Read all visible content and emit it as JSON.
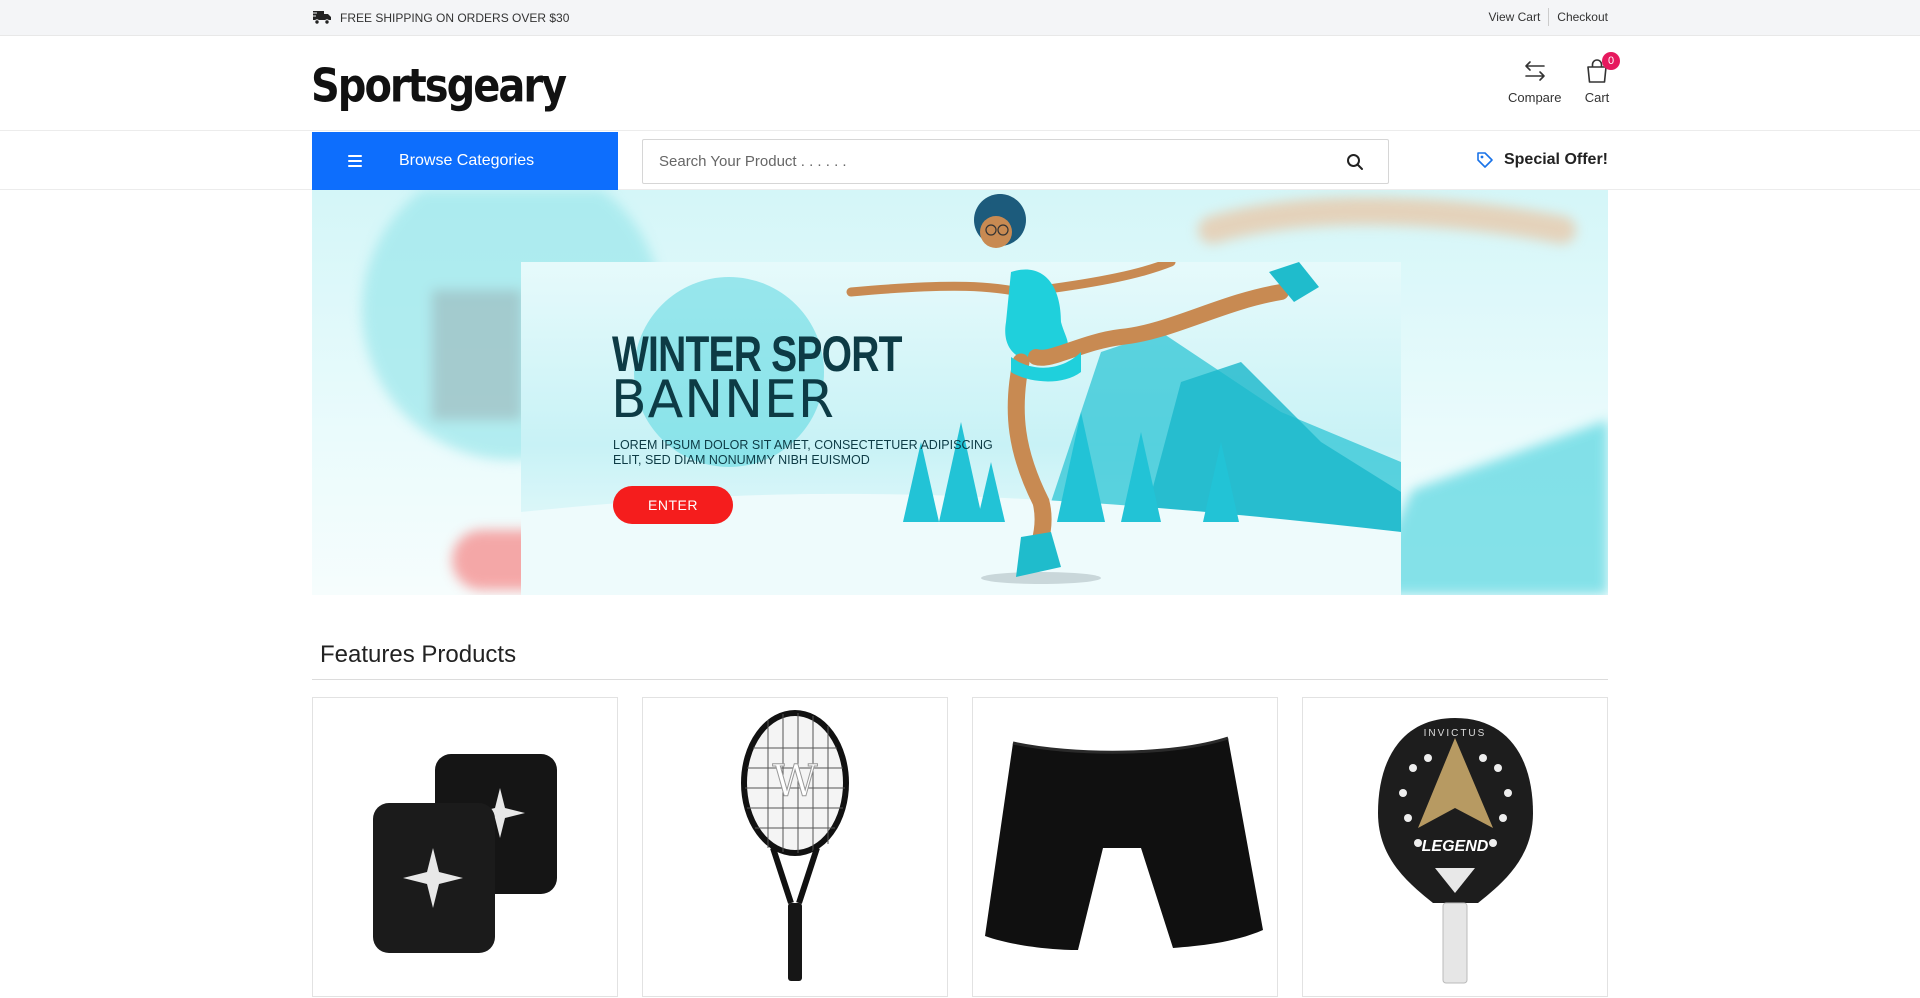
{
  "topbar": {
    "shipping_text": "FREE SHIPPING ON ORDERS OVER $30",
    "view_cart": "View Cart",
    "checkout": "Checkout"
  },
  "header": {
    "logo": "Sportsgeary",
    "compare_label": "Compare",
    "cart_label": "Cart",
    "cart_count": "0"
  },
  "nav": {
    "browse_label": "Browse Categories",
    "search_placeholder": "Search Your Product . . . . . .",
    "special_offer": "Special Offer!"
  },
  "banner": {
    "title_line1": "WINTER SPORT",
    "title_line2": "BANNER",
    "description": "LOREM IPSUM DOLOR SIT AMET, CONSECTETUER ADIPISCING ELIT, SED DIAM NONUMMY NIBH EUISMOD",
    "button_label": "ENTER"
  },
  "features": {
    "title": "Features Products",
    "products": [
      {
        "image": "wristbands-image"
      },
      {
        "image": "tennis-racket-image"
      },
      {
        "image": "black-shorts-image"
      },
      {
        "image": "padel-racket-image",
        "brand_text": "INVICTUS",
        "model_text": "LEGEND"
      }
    ]
  },
  "colors": {
    "primary_blue": "#0d6efd",
    "badge_pink": "#e6195e",
    "enter_red": "#f51d1d",
    "banner_teal": "#1ad3dd"
  }
}
